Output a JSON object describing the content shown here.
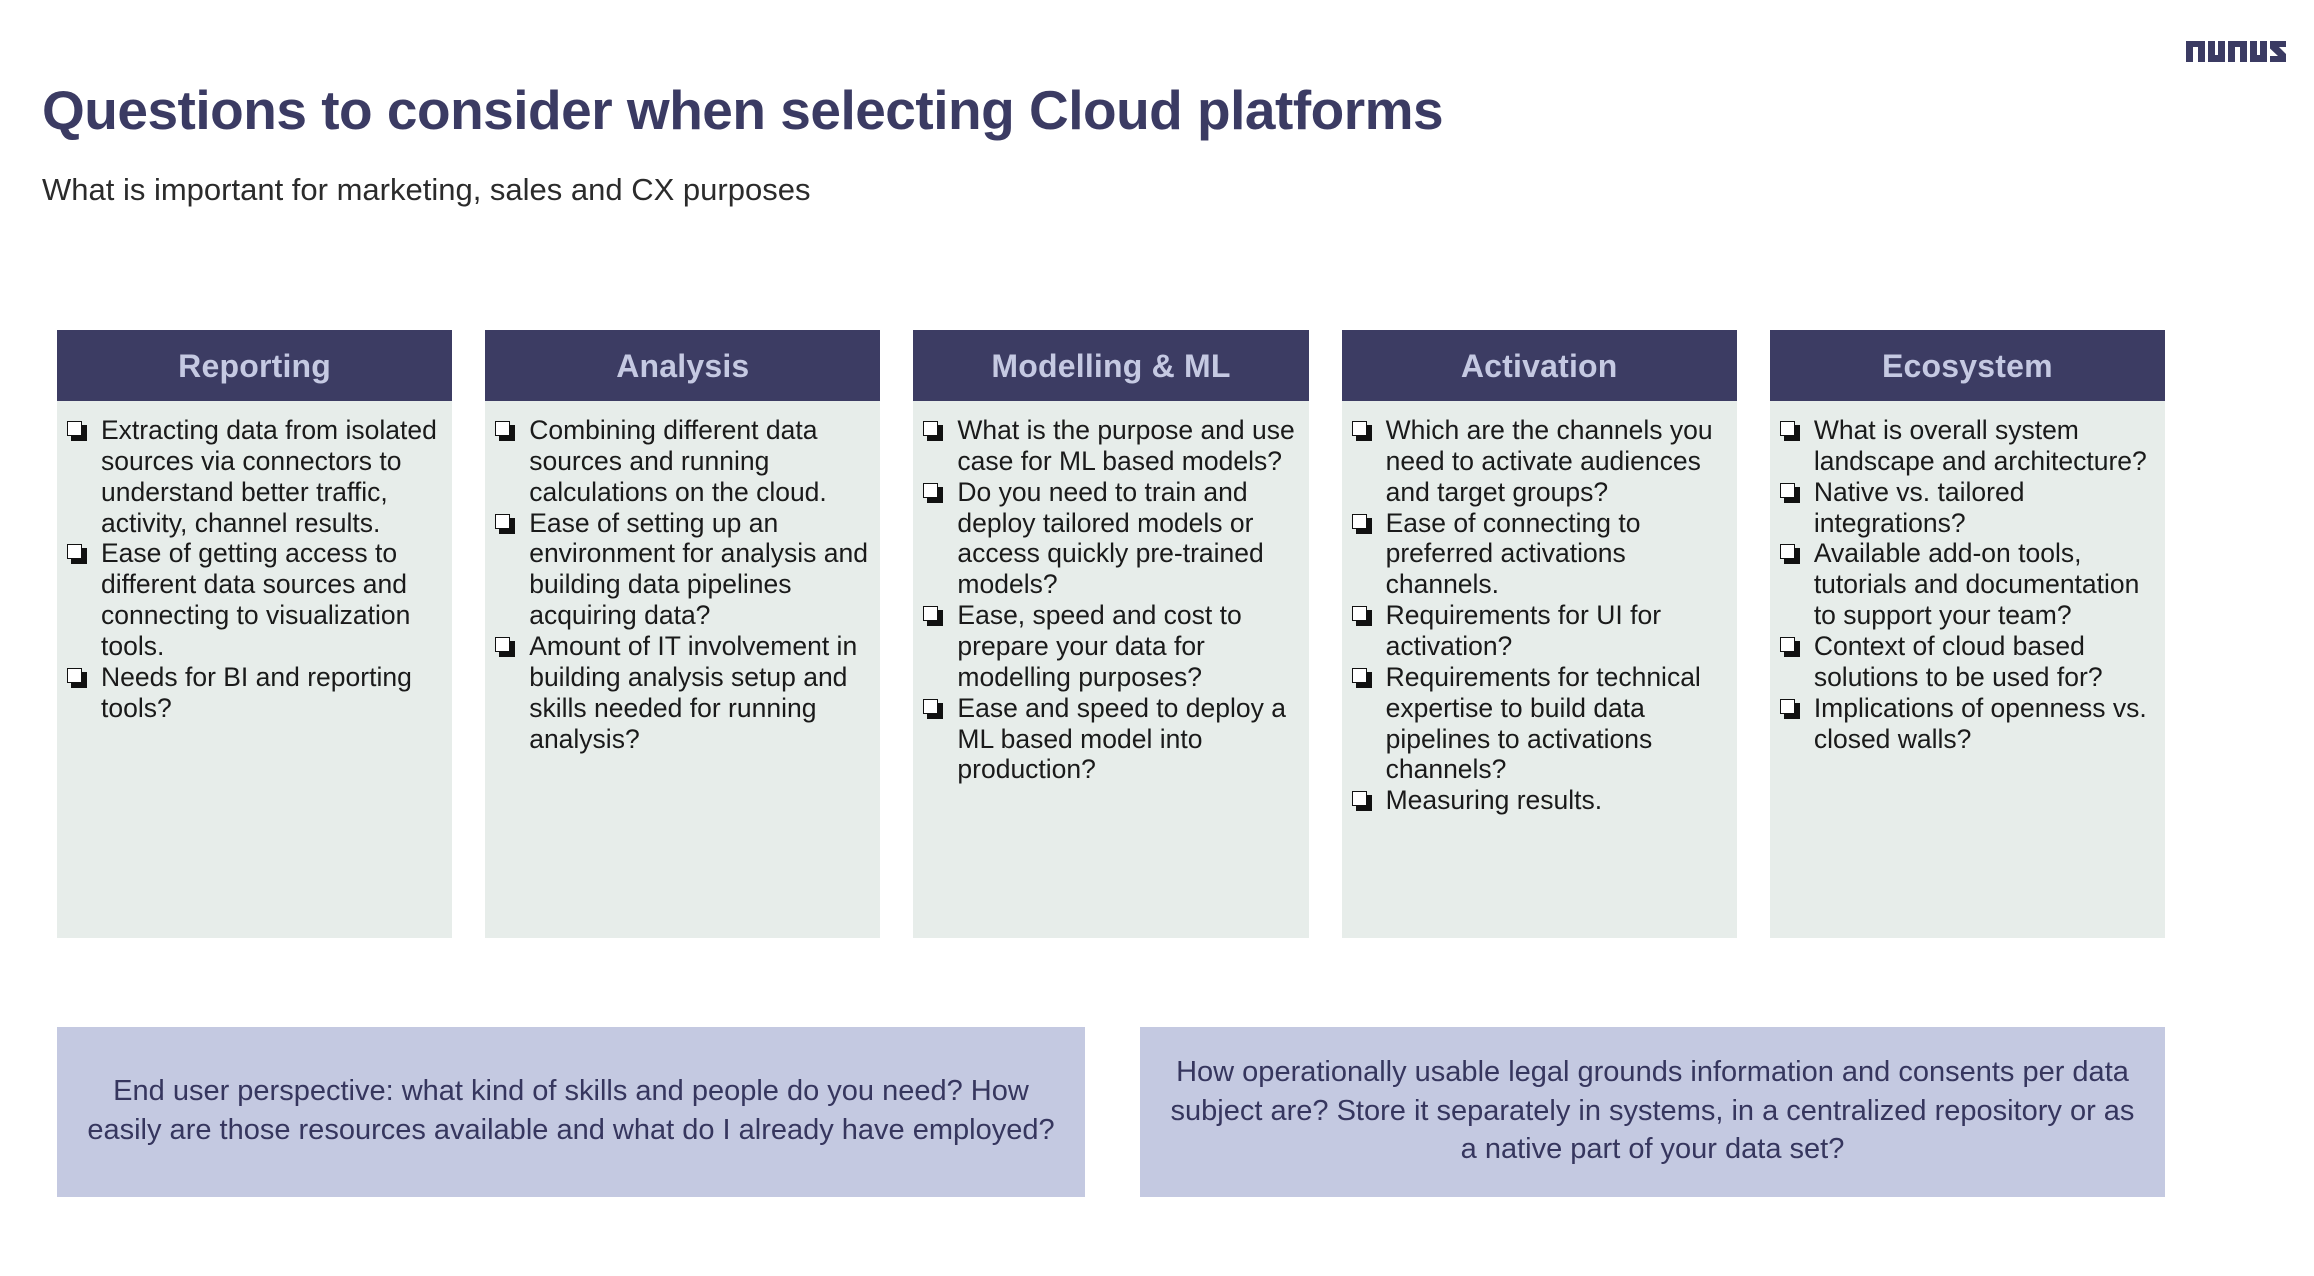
{
  "brand": {
    "logo_text": "avaus",
    "logo_color": "#3b3b63"
  },
  "header": {
    "title": "Questions to consider when selecting Cloud platforms",
    "subtitle": "What is important for marketing, sales and CX purposes"
  },
  "colors": {
    "header_navy": "#3c3c63",
    "header_label": "#c5c9e2",
    "panel_mint": "#e7edea",
    "callout_periwinkle": "#c4c9e1",
    "callout_text": "#36365e",
    "title_navy": "#3b3b63"
  },
  "bullet_icon": "white-square-shadow-icon",
  "columns": [
    {
      "id": "reporting",
      "title": "Reporting",
      "items": [
        "Extracting data from isolated sources via connectors to understand better traffic, activity, channel results.",
        "Ease of getting access to different data sources and connecting to visualization tools.",
        "Needs for BI and reporting tools?"
      ]
    },
    {
      "id": "analysis",
      "title": "Analysis",
      "items": [
        "Combining different data sources and running calculations on the cloud.",
        "Ease of setting up an environment for analysis and building data pipelines acquiring data?",
        "Amount of IT involvement in building analysis setup and skills needed for running analysis?"
      ]
    },
    {
      "id": "modelling-ml",
      "title": "Modelling & ML",
      "items": [
        "What is the purpose and use case for ML based models?",
        "Do you need to train and deploy tailored models or access quickly pre-trained models?",
        "Ease, speed and cost to prepare your data for modelling purposes?",
        "Ease and speed to deploy a ML based model into production?"
      ]
    },
    {
      "id": "activation",
      "title": "Activation",
      "items": [
        "Which are the channels you need to activate audiences and target groups?",
        "Ease of connecting to preferred activations channels.",
        "Requirements for UI for activation?",
        "Requirements for technical expertise to build data pipelines to activations channels?",
        "Measuring results."
      ]
    },
    {
      "id": "ecosystem",
      "title": "Ecosystem",
      "items": [
        "What is overall system landscape and architecture?",
        "Native vs. tailored integrations?",
        "Available add-on tools, tutorials and documentation to support your team?",
        "Context of cloud based solutions to be used for?",
        "Implications of openness vs. closed walls?"
      ]
    }
  ],
  "callouts": [
    {
      "id": "end-user-perspective",
      "text": "End user perspective: what kind of skills and people do you need? How easily are those resources available and what do I already have employed?"
    },
    {
      "id": "legal-grounds",
      "text": "How operationally usable legal grounds information and consents per data subject are? Store it separately in systems, in a centralized repository or as a native part of your data set?"
    }
  ]
}
